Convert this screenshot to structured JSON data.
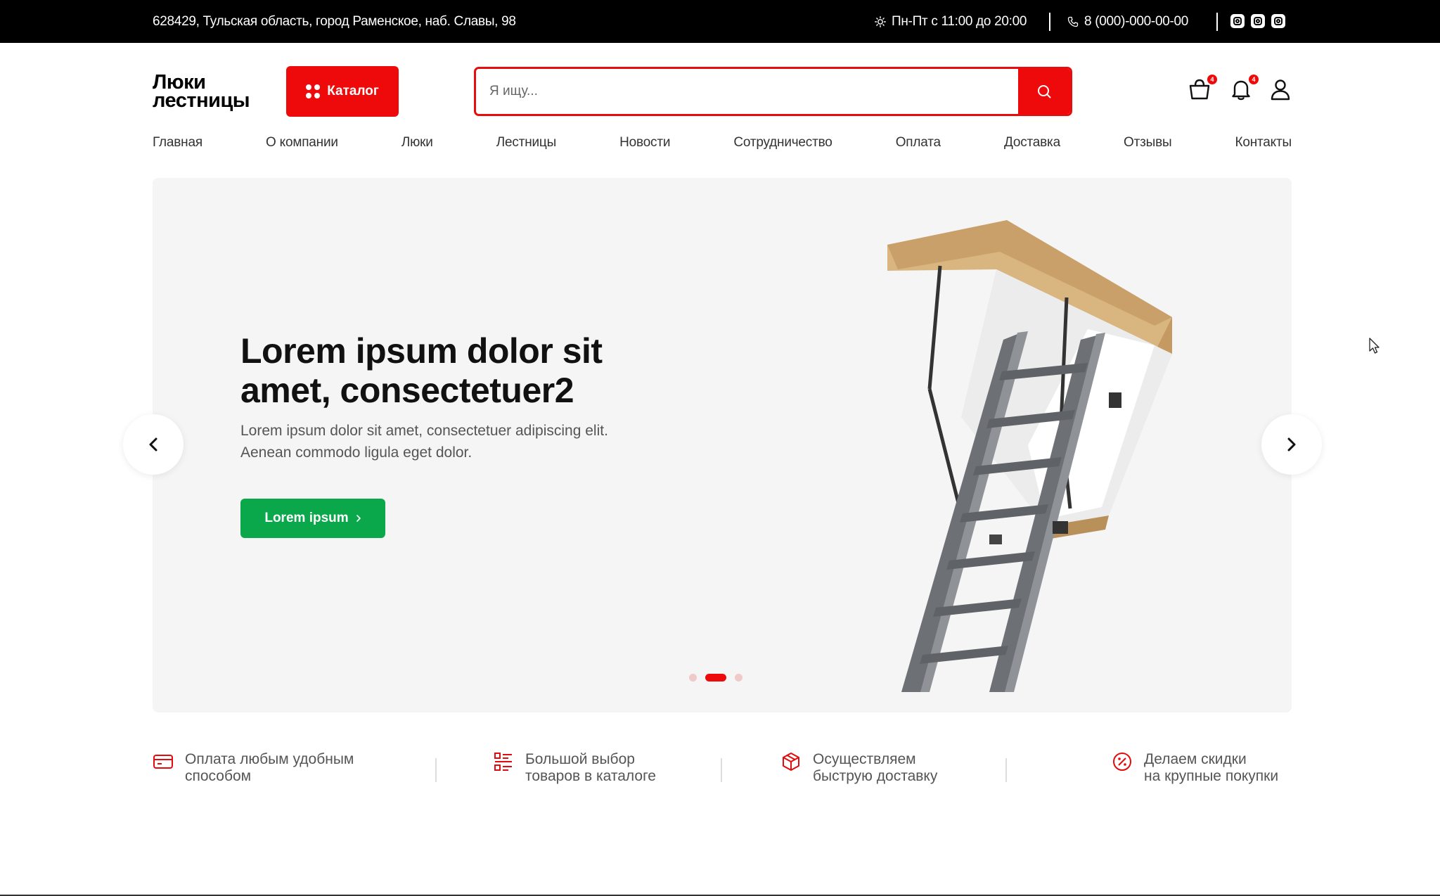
{
  "topbar": {
    "address": "628429, Тульская область, город Раменское, наб. Славы, 98",
    "hours": "Пн-Пт с 11:00 до 20:00",
    "phone": "8 (000)-000-00-00",
    "socials": [
      "instagram-icon",
      "instagram-icon",
      "instagram-icon"
    ]
  },
  "header": {
    "logo_line1": "Люки",
    "logo_line2": "лестницы",
    "catalog_label": "Каталог",
    "search_placeholder": "Я ищу...",
    "cart_count": "4",
    "notifications_count": "4"
  },
  "nav": {
    "items": [
      "Главная",
      "О компании",
      "Люки",
      "Лестницы",
      "Новости",
      "Сотрудничество",
      "Оплата",
      "Доставка",
      "Отзывы",
      "Контакты"
    ]
  },
  "hero": {
    "title": "Lorem ipsum dolor sit amet, consectetuer2",
    "text": "Lorem ipsum dolor sit amet, consectetuer adipiscing elit. Aenean commodo ligula eget dolor.",
    "button_label": "Lorem ipsum",
    "slides_total": 3,
    "active_slide": 2
  },
  "features": [
    {
      "icon": "credit-card-icon",
      "line1": "Оплата любым удобным",
      "line2": "способом"
    },
    {
      "icon": "list-icon",
      "line1": "Большой выбор",
      "line2": "товаров в каталоге"
    },
    {
      "icon": "box-icon",
      "line1": "Осуществляем",
      "line2": "быструю доставку"
    },
    {
      "icon": "discount-icon",
      "line1": "Делаем скидки",
      "line2": "на крупные покупки"
    }
  ],
  "colors": {
    "accent": "#ee0a0a",
    "button_green": "#0aa84a",
    "topbar_bg": "#000000",
    "hero_bg": "#f5f5f5"
  }
}
